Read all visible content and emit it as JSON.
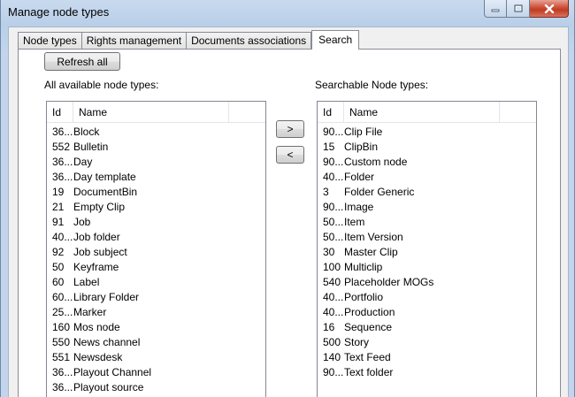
{
  "window": {
    "title": "Manage node types"
  },
  "tabs": [
    {
      "label": "Node types"
    },
    {
      "label": "Rights management"
    },
    {
      "label": "Documents associations"
    },
    {
      "label": "Search"
    }
  ],
  "toolbar": {
    "refresh_label": "Refresh all",
    "add_label": ">",
    "remove_label": "<"
  },
  "available": {
    "heading": "All available node types:",
    "columns": {
      "id": "Id",
      "name": "Name"
    },
    "rows": [
      {
        "id": "36...",
        "name": "Block"
      },
      {
        "id": "552",
        "name": "Bulletin"
      },
      {
        "id": "36...",
        "name": "Day"
      },
      {
        "id": "36...",
        "name": "Day template"
      },
      {
        "id": "19",
        "name": "DocumentBin"
      },
      {
        "id": "21",
        "name": "Empty Clip"
      },
      {
        "id": "91",
        "name": "Job"
      },
      {
        "id": "40...",
        "name": "Job folder"
      },
      {
        "id": "92",
        "name": "Job subject"
      },
      {
        "id": "50",
        "name": "Keyframe"
      },
      {
        "id": "60",
        "name": "Label"
      },
      {
        "id": "60...",
        "name": "Library Folder"
      },
      {
        "id": "25...",
        "name": "Marker"
      },
      {
        "id": "160",
        "name": "Mos node"
      },
      {
        "id": "550",
        "name": "News channel"
      },
      {
        "id": "551",
        "name": "Newsdesk"
      },
      {
        "id": "36...",
        "name": "Playout Channel"
      },
      {
        "id": "36...",
        "name": "Playout source"
      }
    ]
  },
  "searchable": {
    "heading": "Searchable Node types:",
    "columns": {
      "id": "Id",
      "name": "Name"
    },
    "rows": [
      {
        "id": "90...",
        "name": "Clip File"
      },
      {
        "id": "15",
        "name": "ClipBin"
      },
      {
        "id": "90...",
        "name": "Custom node"
      },
      {
        "id": "40...",
        "name": "Folder"
      },
      {
        "id": "3",
        "name": "Folder Generic"
      },
      {
        "id": "90...",
        "name": "Image"
      },
      {
        "id": "50...",
        "name": "Item"
      },
      {
        "id": "50...",
        "name": "Item Version"
      },
      {
        "id": "30",
        "name": "Master Clip"
      },
      {
        "id": "100",
        "name": "Multiclip"
      },
      {
        "id": "540",
        "name": "Placeholder MOGs"
      },
      {
        "id": "40...",
        "name": "Portfolio"
      },
      {
        "id": "40...",
        "name": "Production"
      },
      {
        "id": "16",
        "name": "Sequence"
      },
      {
        "id": "500",
        "name": "Story"
      },
      {
        "id": "140",
        "name": "Text Feed"
      },
      {
        "id": "90...",
        "name": "Text folder"
      }
    ]
  }
}
